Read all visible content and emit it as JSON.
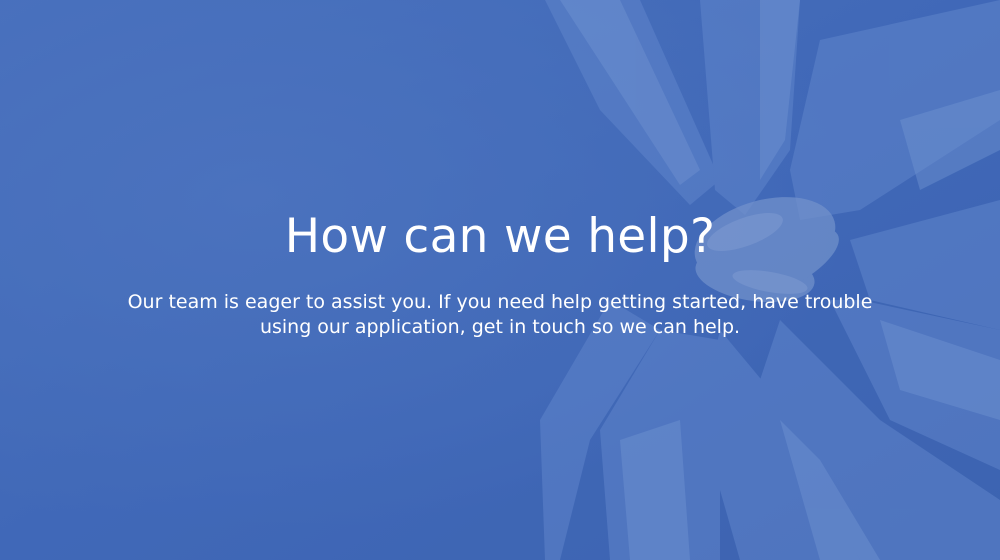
{
  "hero": {
    "title": "How can we help?",
    "subtitle": "Our team is eager to assist you. If you need help getting started, have trouble using our application, get in touch so we can help.",
    "overlay_color": "#4169b8",
    "image_subject": "team-hands-stacked-photo"
  }
}
